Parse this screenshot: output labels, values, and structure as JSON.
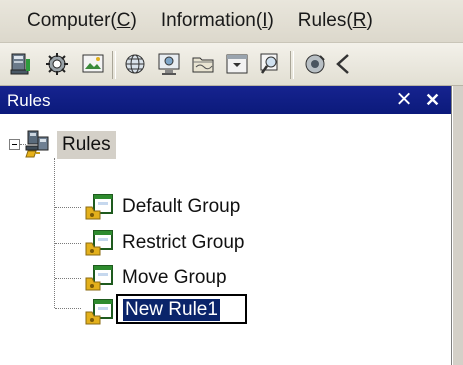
{
  "menu": {
    "items": [
      {
        "pre": "Computer(",
        "key": "C",
        "post": ")"
      },
      {
        "pre": "Information(",
        "key": "I",
        "post": ")"
      },
      {
        "pre": "Rules(",
        "key": "R",
        "post": ")"
      }
    ]
  },
  "toolbar": {
    "buttons": [
      "computer-icon",
      "settings-icon",
      "image-icon",
      "globe-icon",
      "monitor-icon",
      "folder-icon",
      "window-icon",
      "search-icon",
      "camera-icon",
      "arrow-icon"
    ]
  },
  "panel": {
    "title": "Rules",
    "pin_glyph": "྾",
    "close_glyph": "✕"
  },
  "tree": {
    "root": {
      "label": "Rules",
      "icon": "network-computers-icon",
      "expanded": true
    },
    "children": [
      {
        "label": "Default Group",
        "icon": "rule-group-icon"
      },
      {
        "label": "Restrict Group",
        "icon": "rule-group-icon"
      },
      {
        "label": "Move Group",
        "icon": "rule-group-icon"
      },
      {
        "label": "New Rule1",
        "icon": "rule-group-icon",
        "editing": true
      }
    ]
  },
  "colors": {
    "titlebar": "#0b1a7b",
    "selection": "#0a246a",
    "chrome": "#d4d0c8"
  }
}
